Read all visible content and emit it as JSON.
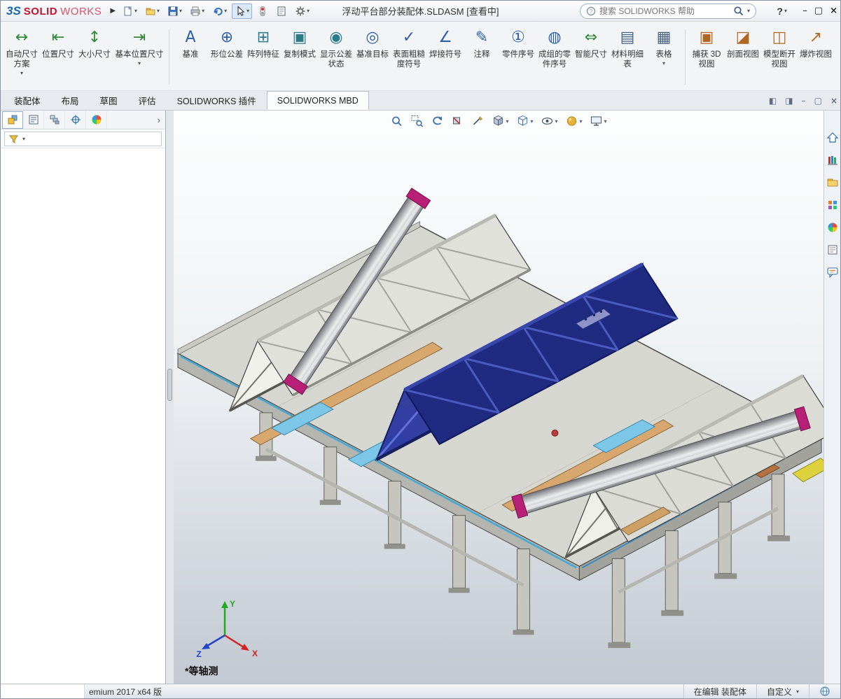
{
  "glyphs": {
    "caret_down": "▾",
    "chevron_right": "›",
    "flyout": "▶"
  },
  "colors": {
    "brand_red": "#c8102e",
    "truss_blue": "#2a37a0",
    "magenta_cap": "#b81f77",
    "cyan_part": "#7cc7e8",
    "tan_part": "#d8a76e",
    "viewport_gradient_top": "#fdfefe",
    "viewport_gradient_bottom": "#c2c9d2"
  },
  "titlebar": {
    "brand": {
      "mark": "3S",
      "solid": "SOLID",
      "works": "WORKS"
    },
    "tools": [
      {
        "name": "new"
      },
      {
        "name": "open"
      },
      {
        "name": "save"
      },
      {
        "name": "print"
      },
      {
        "name": "undo"
      },
      {
        "name": "select"
      },
      {
        "name": "rebuild"
      },
      {
        "name": "file-properties"
      },
      {
        "name": "options"
      }
    ],
    "title": "浮动平台部分装配体.SLDASM [查看中]",
    "search_placeholder": "搜索 SOLIDWORKS 帮助",
    "help": "?",
    "window_controls": {
      "minimize": "–",
      "restore": "▢",
      "close": "×"
    }
  },
  "ribbon": {
    "buttons": [
      {
        "label": "自动尺寸方案",
        "glyph": "↔",
        "dropdown": true
      },
      {
        "label": "位置尺寸",
        "glyph": "⇤"
      },
      {
        "label": "大小尺寸",
        "glyph": "↕"
      },
      {
        "label": "基本位置尺寸",
        "glyph": "⇥",
        "dropdown": true
      },
      {
        "label": "基准",
        "glyph": "A"
      },
      {
        "label": "形位公差",
        "glyph": "⊕"
      },
      {
        "label": "阵列特征",
        "glyph": "⊞"
      },
      {
        "label": "复制模式",
        "glyph": "▣"
      },
      {
        "label": "显示公差状态",
        "glyph": "◉"
      },
      {
        "label": "基准目标",
        "glyph": "◎"
      },
      {
        "label": "表面粗糙度符号",
        "glyph": "✓"
      },
      {
        "label": "焊接符号",
        "glyph": "∠"
      },
      {
        "label": "注释",
        "glyph": "✎"
      },
      {
        "label": "零件序号",
        "glyph": "①"
      },
      {
        "label": "成组的零件序号",
        "glyph": "◍"
      },
      {
        "label": "智能尺寸",
        "glyph": "⇔"
      },
      {
        "label": "材料明细表",
        "glyph": "▤"
      },
      {
        "label": "表格",
        "glyph": "▦",
        "dropdown": true
      },
      {
        "label": "捕获 3D 视图",
        "glyph": "▣"
      },
      {
        "label": "剖面视图",
        "glyph": "◪"
      },
      {
        "label": "模型断开视图",
        "glyph": "◫"
      },
      {
        "label": "爆炸视图",
        "glyph": "↗"
      }
    ]
  },
  "tabs": [
    {
      "label": "装配体"
    },
    {
      "label": "布局"
    },
    {
      "label": "草图"
    },
    {
      "label": "评估"
    },
    {
      "label": "SOLIDWORKS 插件"
    },
    {
      "label": "SOLIDWORKS MBD",
      "active": true
    }
  ],
  "doc_controls": {
    "prev": "◧",
    "next": "◨",
    "minimize": "–",
    "restore": "▢",
    "close": "×"
  },
  "feature_panel": {
    "tabs": [
      {
        "name": "feature-manager"
      },
      {
        "name": "property-manager"
      },
      {
        "name": "configuration-manager"
      },
      {
        "name": "dimxpert-manager"
      },
      {
        "name": "display-manager"
      }
    ],
    "filter": {
      "name": "filter-funnel"
    }
  },
  "headsup": [
    {
      "name": "zoom-to-fit"
    },
    {
      "name": "zoom-to-area"
    },
    {
      "name": "previous-view"
    },
    {
      "name": "section-view"
    },
    {
      "name": "annotation-views"
    },
    {
      "name": "view-orientation",
      "dropdown": true
    },
    {
      "name": "display-style",
      "dropdown": true
    },
    {
      "name": "hide-show-items",
      "dropdown": true
    },
    {
      "name": "edit-appearance",
      "dropdown": true
    },
    {
      "name": "view-settings",
      "dropdown": true
    }
  ],
  "task_pane": [
    {
      "name": "solidworks-resources"
    },
    {
      "name": "design-library"
    },
    {
      "name": "file-explorer"
    },
    {
      "name": "view-palette"
    },
    {
      "name": "appearances-scenes"
    },
    {
      "name": "custom-properties"
    },
    {
      "name": "solidworks-forum"
    }
  ],
  "viewport": {
    "view_label": "*等轴测",
    "triad": {
      "x": "X",
      "y": "Y",
      "z": "Z"
    }
  },
  "statusbar": {
    "left": "emium 2017 x64 版",
    "editing": "在编辑 装配体",
    "custom": "自定义"
  }
}
